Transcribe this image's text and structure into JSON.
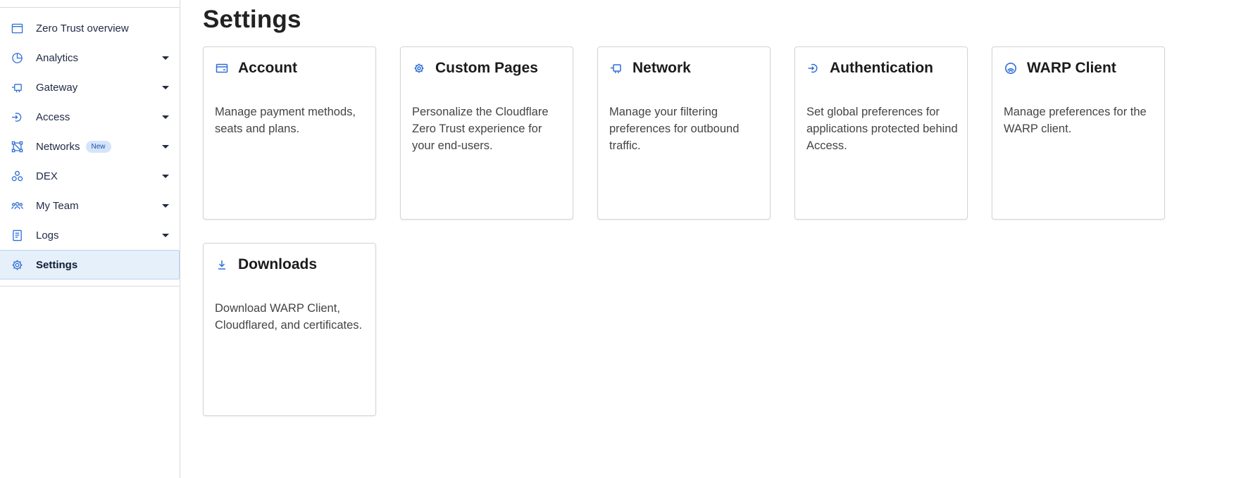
{
  "sidebar": {
    "items": [
      {
        "label": "Zero Trust overview",
        "icon": "browser-window-icon",
        "has_caret": false
      },
      {
        "label": "Analytics",
        "icon": "pie-chart-icon",
        "has_caret": true
      },
      {
        "label": "Gateway",
        "icon": "gateway-icon",
        "has_caret": true
      },
      {
        "label": "Access",
        "icon": "access-icon",
        "has_caret": true
      },
      {
        "label": "Networks",
        "icon": "network-nodes-icon",
        "has_caret": true,
        "badge": "New"
      },
      {
        "label": "DEX",
        "icon": "dex-icon",
        "has_caret": true
      },
      {
        "label": "My Team",
        "icon": "team-icon",
        "has_caret": true
      },
      {
        "label": "Logs",
        "icon": "logs-icon",
        "has_caret": true
      },
      {
        "label": "Settings",
        "icon": "gear-icon",
        "has_caret": false,
        "active": true
      }
    ]
  },
  "main": {
    "title": "Settings",
    "cards": [
      {
        "title": "Account",
        "icon": "credit-card-icon",
        "description": "Manage payment methods, seats and plans."
      },
      {
        "title": "Custom Pages",
        "icon": "gear-icon",
        "description": "Personalize the Cloudflare Zero Trust experience for your end-users."
      },
      {
        "title": "Network",
        "icon": "network-icon",
        "description": "Manage your filtering preferences for outbound traffic."
      },
      {
        "title": "Authentication",
        "icon": "authentication-icon",
        "description": "Set global preferences for applications protected behind Access."
      },
      {
        "title": "WARP Client",
        "icon": "warp-icon",
        "description": "Manage preferences for the WARP client."
      },
      {
        "title": "Downloads",
        "icon": "download-icon",
        "description": "Download WARP Client, Cloudflared, and certificates."
      }
    ]
  },
  "colors": {
    "accent": "#2f6fd6",
    "active_bg": "#e6f0fb",
    "badge_bg": "#d4e4fb"
  }
}
